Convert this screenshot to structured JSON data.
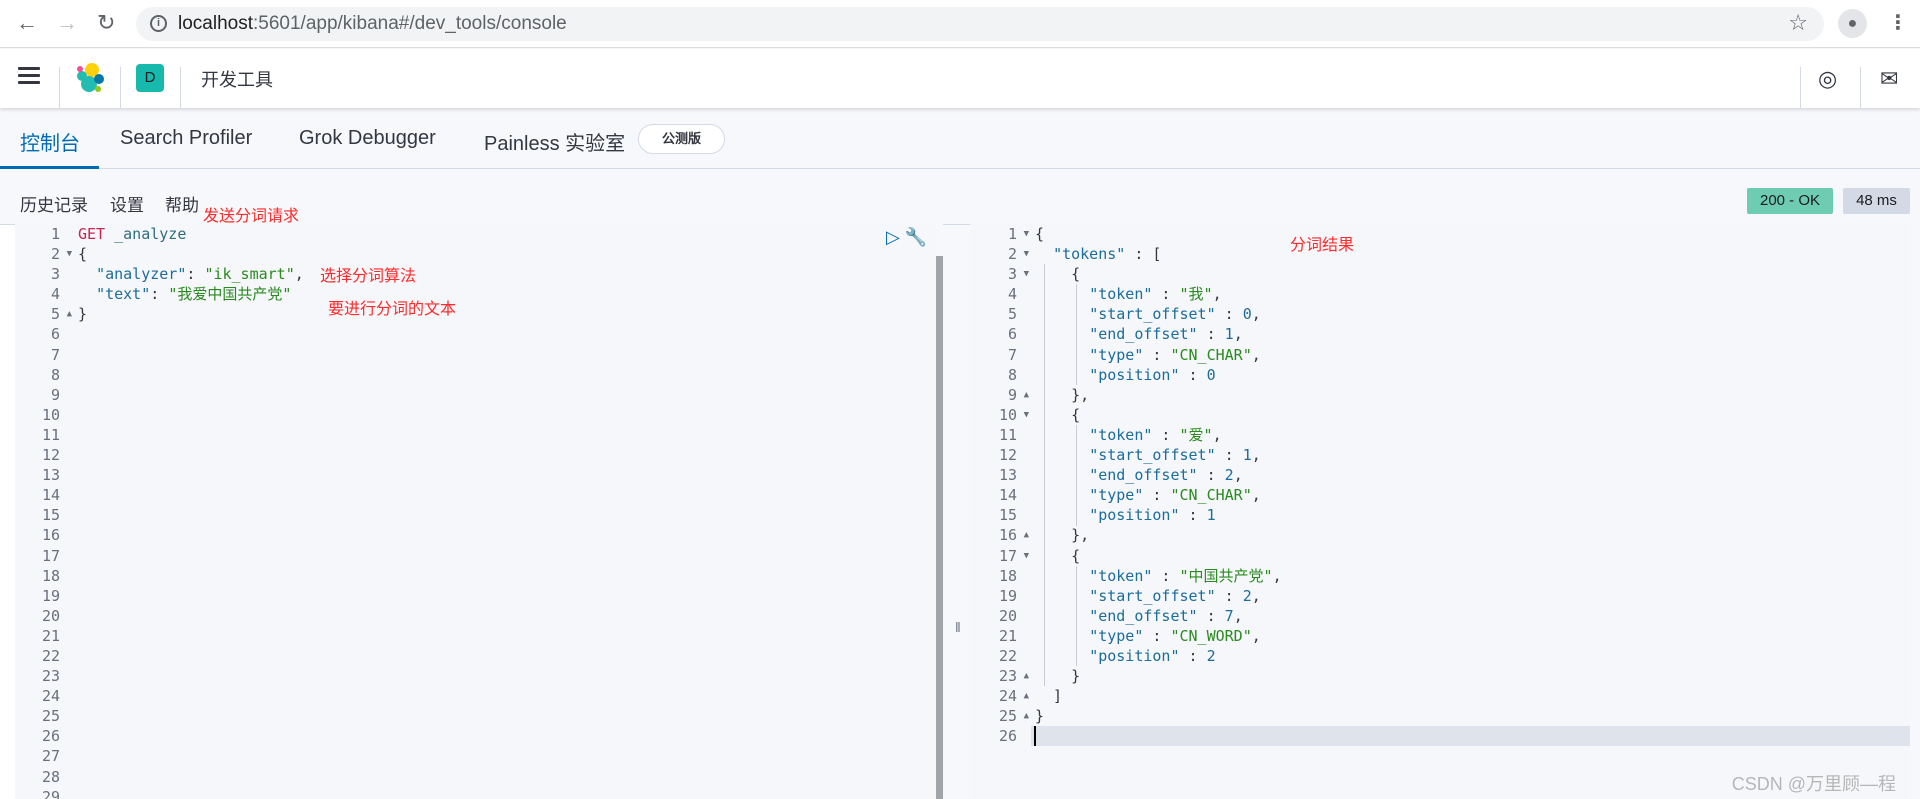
{
  "browser": {
    "url_host": "localhost",
    "url_rest": ":5601/app/kibana#/dev_tools/console",
    "icons": [
      "back-icon",
      "forward-icon",
      "reload-icon",
      "info-icon",
      "star-icon",
      "profile-icon",
      "kebab-menu-icon"
    ]
  },
  "header": {
    "space_initial": "D",
    "breadcrumb": "开发工具",
    "icons": [
      "menu-icon",
      "elastic-logo",
      "help-icon",
      "mail-icon"
    ]
  },
  "tabs": [
    {
      "label": "控制台",
      "active": true
    },
    {
      "label": "Search Profiler",
      "active": false
    },
    {
      "label": "Grok Debugger",
      "active": false
    },
    {
      "label": "Painless 实验室",
      "active": false
    }
  ],
  "beta_badge": "公测版",
  "toolbar": {
    "history": "历史记录",
    "settings": "设置",
    "help": "帮助"
  },
  "response_status": {
    "status": "200 - OK",
    "time": "48 ms",
    "status_color": "#6dccb1",
    "time_color": "#d3dae6"
  },
  "annotations": {
    "send_request": "发送分词请求",
    "choose_algorithm": "选择分词算法",
    "text_to_analyze": "要进行分词的文本",
    "result": "分词结果"
  },
  "request_editor": {
    "line_count": 29,
    "folds": {
      "2": "down",
      "5": "up"
    },
    "lines": [
      [
        [
          "kw",
          "GET"
        ],
        [
          "url",
          " _analyze"
        ]
      ],
      [
        [
          "punc",
          "{"
        ]
      ],
      [
        [
          "punc",
          "  "
        ],
        [
          "key",
          "\"analyzer\""
        ],
        [
          "punc",
          ": "
        ],
        [
          "str",
          "\"ik_smart\""
        ],
        [
          "punc",
          ","
        ]
      ],
      [
        [
          "punc",
          "  "
        ],
        [
          "key",
          "\"text\""
        ],
        [
          "punc",
          ": "
        ],
        [
          "str",
          "\"我爱中国共产党\""
        ]
      ],
      [
        [
          "punc",
          "}"
        ]
      ]
    ]
  },
  "response_editor": {
    "line_count": 26,
    "active_line": 26,
    "folds": {
      "1": "down",
      "2": "down",
      "3": "down",
      "9": "up",
      "10": "down",
      "16": "up",
      "17": "down",
      "23": "up",
      "24": "up",
      "25": "up"
    },
    "lines": [
      [
        [
          "punc",
          "{"
        ]
      ],
      [
        [
          "punc",
          "  "
        ],
        [
          "key",
          "\"tokens\""
        ],
        [
          "punc",
          " : ["
        ]
      ],
      [
        [
          "punc",
          "    {"
        ]
      ],
      [
        [
          "punc",
          "      "
        ],
        [
          "key",
          "\"token\""
        ],
        [
          "punc",
          " : "
        ],
        [
          "str",
          "\"我\""
        ],
        [
          "punc",
          ","
        ]
      ],
      [
        [
          "punc",
          "      "
        ],
        [
          "key",
          "\"start_offset\""
        ],
        [
          "punc",
          " : "
        ],
        [
          "num",
          "0"
        ],
        [
          "punc",
          ","
        ]
      ],
      [
        [
          "punc",
          "      "
        ],
        [
          "key",
          "\"end_offset\""
        ],
        [
          "punc",
          " : "
        ],
        [
          "num",
          "1"
        ],
        [
          "punc",
          ","
        ]
      ],
      [
        [
          "punc",
          "      "
        ],
        [
          "key",
          "\"type\""
        ],
        [
          "punc",
          " : "
        ],
        [
          "str",
          "\"CN_CHAR\""
        ],
        [
          "punc",
          ","
        ]
      ],
      [
        [
          "punc",
          "      "
        ],
        [
          "key",
          "\"position\""
        ],
        [
          "punc",
          " : "
        ],
        [
          "num",
          "0"
        ]
      ],
      [
        [
          "punc",
          "    },"
        ]
      ],
      [
        [
          "punc",
          "    {"
        ]
      ],
      [
        [
          "punc",
          "      "
        ],
        [
          "key",
          "\"token\""
        ],
        [
          "punc",
          " : "
        ],
        [
          "str",
          "\"爱\""
        ],
        [
          "punc",
          ","
        ]
      ],
      [
        [
          "punc",
          "      "
        ],
        [
          "key",
          "\"start_offset\""
        ],
        [
          "punc",
          " : "
        ],
        [
          "num",
          "1"
        ],
        [
          "punc",
          ","
        ]
      ],
      [
        [
          "punc",
          "      "
        ],
        [
          "key",
          "\"end_offset\""
        ],
        [
          "punc",
          " : "
        ],
        [
          "num",
          "2"
        ],
        [
          "punc",
          ","
        ]
      ],
      [
        [
          "punc",
          "      "
        ],
        [
          "key",
          "\"type\""
        ],
        [
          "punc",
          " : "
        ],
        [
          "str",
          "\"CN_CHAR\""
        ],
        [
          "punc",
          ","
        ]
      ],
      [
        [
          "punc",
          "      "
        ],
        [
          "key",
          "\"position\""
        ],
        [
          "punc",
          " : "
        ],
        [
          "num",
          "1"
        ]
      ],
      [
        [
          "punc",
          "    },"
        ]
      ],
      [
        [
          "punc",
          "    {"
        ]
      ],
      [
        [
          "punc",
          "      "
        ],
        [
          "key",
          "\"token\""
        ],
        [
          "punc",
          " : "
        ],
        [
          "str",
          "\"中国共产党\""
        ],
        [
          "punc",
          ","
        ]
      ],
      [
        [
          "punc",
          "      "
        ],
        [
          "key",
          "\"start_offset\""
        ],
        [
          "punc",
          " : "
        ],
        [
          "num",
          "2"
        ],
        [
          "punc",
          ","
        ]
      ],
      [
        [
          "punc",
          "      "
        ],
        [
          "key",
          "\"end_offset\""
        ],
        [
          "punc",
          " : "
        ],
        [
          "num",
          "7"
        ],
        [
          "punc",
          ","
        ]
      ],
      [
        [
          "punc",
          "      "
        ],
        [
          "key",
          "\"type\""
        ],
        [
          "punc",
          " : "
        ],
        [
          "str",
          "\"CN_WORD\""
        ],
        [
          "punc",
          ","
        ]
      ],
      [
        [
          "punc",
          "      "
        ],
        [
          "key",
          "\"position\""
        ],
        [
          "punc",
          " : "
        ],
        [
          "num",
          "2"
        ]
      ],
      [
        [
          "punc",
          "    }"
        ]
      ],
      [
        [
          "punc",
          "  ]"
        ]
      ],
      [
        [
          "punc",
          "}"
        ]
      ],
      []
    ]
  },
  "watermark": "CSDN @万里顾—程"
}
